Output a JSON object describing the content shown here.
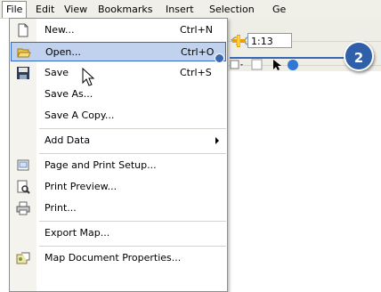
{
  "menubar": {
    "items": [
      "File",
      "Edit",
      "View",
      "Bookmarks",
      "Insert",
      "Selection",
      "Ge"
    ]
  },
  "toolbar": {
    "scale_value": "1:13"
  },
  "file_menu": {
    "items": [
      {
        "label": "New...",
        "shortcut": "Ctrl+N",
        "icon": "new-document-icon"
      },
      {
        "label": "Open...",
        "shortcut": "Ctrl+O",
        "icon": "open-folder-icon"
      },
      {
        "label": "Save",
        "shortcut": "Ctrl+S",
        "icon": "save-disk-icon"
      },
      {
        "label": "Save As...",
        "shortcut": ""
      },
      {
        "label": "Save A Copy...",
        "shortcut": ""
      },
      {
        "label": "Add Data",
        "shortcut": ""
      },
      {
        "label": "Page and Print Setup...",
        "shortcut": "",
        "icon": "page-setup-icon"
      },
      {
        "label": "Print Preview...",
        "shortcut": "",
        "icon": "print-preview-icon"
      },
      {
        "label": "Print...",
        "shortcut": "",
        "icon": "printer-icon"
      },
      {
        "label": "Export Map...",
        "shortcut": ""
      },
      {
        "label": "Map Document Properties...",
        "shortcut": "",
        "icon": "map-properties-icon"
      }
    ]
  },
  "callout": {
    "number": "2",
    "color": "#2f5fa8"
  },
  "colors": {
    "highlight_bg": "#c1d2ee",
    "highlight_border": "#316ac5"
  }
}
